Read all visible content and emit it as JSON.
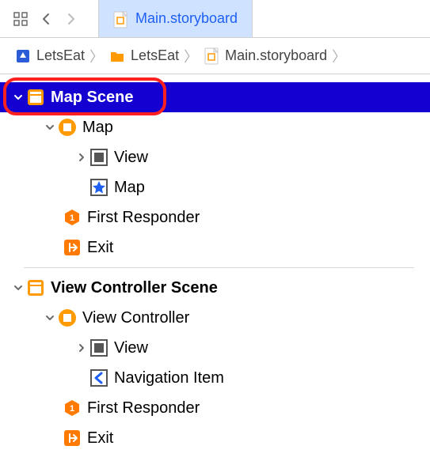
{
  "toolbar": {
    "tab_label": "Main.storyboard"
  },
  "breadcrumb": {
    "items": [
      {
        "label": "LetsEat",
        "icon": "project"
      },
      {
        "label": "LetsEat",
        "icon": "folder"
      },
      {
        "label": "Main.storyboard",
        "icon": "storyboard"
      }
    ]
  },
  "outline": {
    "scenes": [
      {
        "label": "Map Scene",
        "selected": true,
        "highlighted": true,
        "controller": {
          "label": "Map",
          "children": [
            {
              "label": "View",
              "icon": "view",
              "expandable": true
            },
            {
              "label": "Map",
              "icon": "map",
              "expandable": false
            }
          ]
        },
        "responder_label": "First Responder",
        "exit_label": "Exit"
      },
      {
        "label": "View Controller Scene",
        "selected": false,
        "highlighted": false,
        "controller": {
          "label": "View Controller",
          "children": [
            {
              "label": "View",
              "icon": "view",
              "expandable": true
            },
            {
              "label": "Navigation Item",
              "icon": "nav-item",
              "expandable": false
            }
          ]
        },
        "responder_label": "First Responder",
        "exit_label": "Exit"
      }
    ]
  }
}
